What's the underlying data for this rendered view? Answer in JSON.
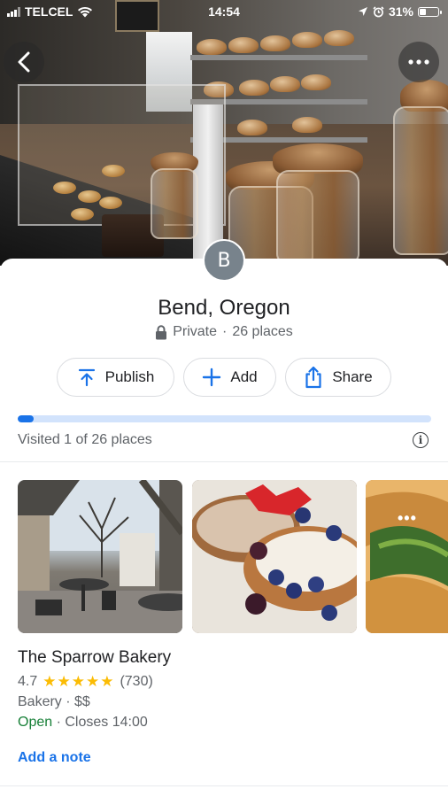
{
  "status_bar": {
    "carrier": "TELCEL",
    "time": "14:54",
    "battery": "31%",
    "icons": [
      "signal-icon",
      "wifi-icon",
      "location-arrow-icon",
      "alarm-icon",
      "battery-icon"
    ]
  },
  "header": {
    "back_icon": "chevron-left-icon",
    "more_icon": "more-horizontal-icon"
  },
  "list": {
    "avatar_letter": "B",
    "title": "Bend, Oregon",
    "privacy": "Private",
    "separator": "·",
    "count_label": "26 places"
  },
  "actions": [
    {
      "label": "Publish",
      "icon": "publish-upload-icon"
    },
    {
      "label": "Add",
      "icon": "plus-icon"
    },
    {
      "label": "Share",
      "icon": "share-icon"
    }
  ],
  "progress": {
    "fraction": 0.0385,
    "label": "Visited 1 of 26 places"
  },
  "place": {
    "name": "The Sparrow Bakery",
    "rating": "4.7",
    "stars": "★★★★★",
    "reviews": "(730)",
    "category": "Bakery · $$",
    "status": "Open",
    "hours": " · Closes 14:00",
    "note_link": "Add a note"
  },
  "colors": {
    "accent": "#1a73e8",
    "open": "#188038",
    "star": "#fbbc04",
    "progress_track": "#d2e3fc"
  }
}
